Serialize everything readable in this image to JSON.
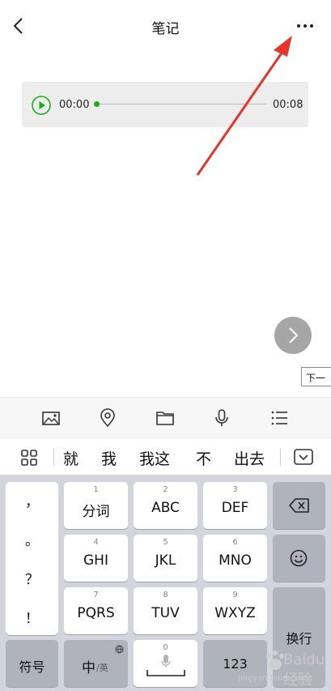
{
  "header": {
    "title": "笔记"
  },
  "audio": {
    "current_time": "00:00",
    "duration": "00:08",
    "progress_fraction": 0.0
  },
  "tooltip": {
    "text": "下一"
  },
  "toolbar": {
    "icons": [
      "image-icon",
      "location-icon",
      "folder-icon",
      "microphone-icon",
      "list-icon"
    ]
  },
  "candidates": [
    "就",
    "我",
    "我这",
    "不",
    "出去"
  ],
  "keyboard": {
    "punct": [
      "，",
      "。",
      "？",
      "！"
    ],
    "keys": [
      {
        "num": "1",
        "label": "分词"
      },
      {
        "num": "2",
        "label": "ABC"
      },
      {
        "num": "3",
        "label": "DEF"
      },
      {
        "num": "4",
        "label": "GHI"
      },
      {
        "num": "5",
        "label": "JKL"
      },
      {
        "num": "6",
        "label": "MNO"
      },
      {
        "num": "7",
        "label": "PQRS"
      },
      {
        "num": "8",
        "label": "TUV"
      },
      {
        "num": "9",
        "label": "WXYZ"
      }
    ],
    "symbol_label": "符号",
    "lang_label": "中",
    "lang_sub": "/英",
    "space_num": "0",
    "num_label": "123",
    "enter_label": "换行"
  },
  "watermark": {
    "text": "Baidu 经验",
    "url": "jingyan.baidu.com"
  },
  "colors": {
    "accent_green": "#1aad19",
    "annotation_red": "#e8332a",
    "keyboard_bg": "#d2d5db"
  }
}
